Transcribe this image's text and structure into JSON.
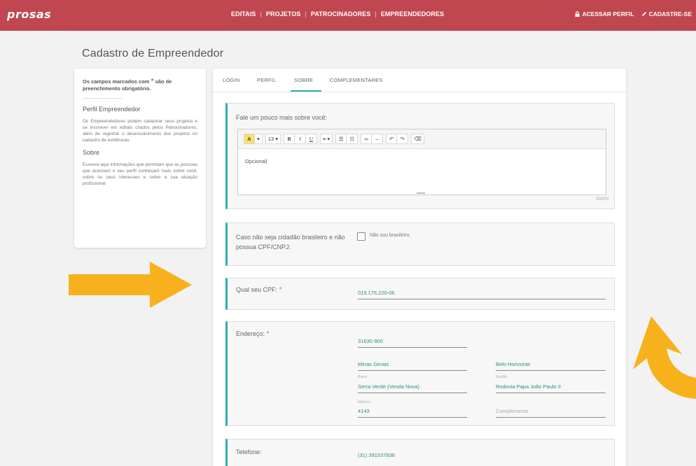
{
  "brand": {
    "logo": "prosas"
  },
  "nav": {
    "items": [
      "EDITAIS",
      "PROJETOS",
      "PATROCINADORES",
      "EMPREENDEDORES"
    ],
    "separator": "|"
  },
  "user_nav": {
    "login": "ACESSAR PERFIL",
    "signup": "CADASTRE-SE"
  },
  "page": {
    "title": "Cadastro de Empreendedor"
  },
  "sidebar": {
    "required_prefix": "Os campos marcados com",
    "required_star": "*",
    "required_suffix": "são de preenchimento obrigatório.",
    "profile_heading": "Perfil Empreendedor",
    "profile_text": "Os Empreendedores podem cadastrar seus projetos e se inscrever em editais criados pelos Patrocinadores, além de registrar o desenvolvimento dos projetos no cadastro de evidências.",
    "about_heading": "Sobre",
    "about_text": "Escreva aqui informações que permitam que as pessoas que acessam o seu perfil conheçam mais sobre você, sobre os seus interesses e sobre a sua atuação profissional"
  },
  "tabs": [
    {
      "label": "LOGIN"
    },
    {
      "label": "PERFIL"
    },
    {
      "label": "SOBRE",
      "active": true
    },
    {
      "label": "COMPLEMENTARES"
    }
  ],
  "about": {
    "label": "Fale um pouco mais sobre você:",
    "toolbar": {
      "font_size": "13",
      "bold": "B",
      "italic": "I",
      "underline": "U"
    },
    "placeholder": "Opcional",
    "counter": "0/8000"
  },
  "foreign": {
    "label": "Caso não seja cidadão brasileiro e não possua CPF/CNPJ:",
    "checkbox_label": "Não sou brasileiro.",
    "checked": false
  },
  "cpf": {
    "label": "Qual seu CPF:",
    "star": "*",
    "value": "019.176.220-06"
  },
  "address": {
    "label": "Endereço:",
    "star": "*",
    "cep": "31630-900",
    "state": "Minas Gerais",
    "city": "Belo Horizonte",
    "district_hint": "Bairro",
    "district": "Serra Verde (Venda Nova)",
    "street_hint": "Rua/Av",
    "street": "Rodovia Papa João Paulo II",
    "number_hint": "Número",
    "number": "4143",
    "complement_placeholder": "Complemento"
  },
  "phone": {
    "label": "Telefone:",
    "value": "(31) 391537836"
  },
  "colors": {
    "brand": "#c0474f",
    "accent": "#2bb0a8",
    "arrow": "#f7b11c"
  }
}
